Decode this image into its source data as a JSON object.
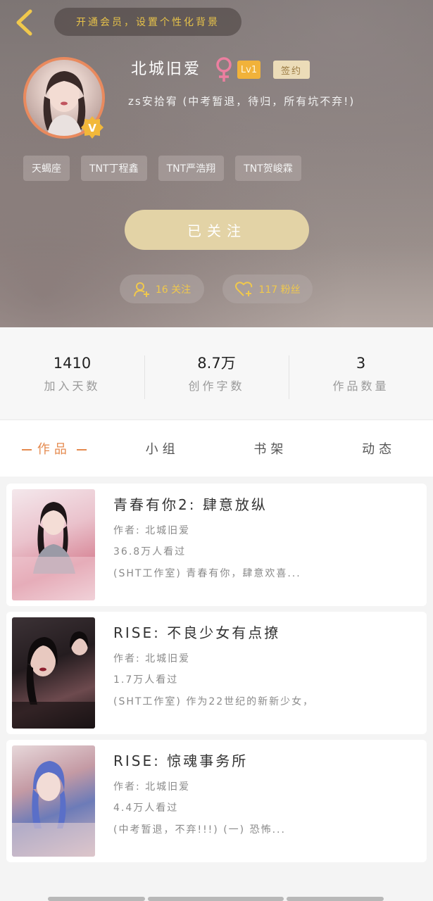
{
  "header": {
    "vip_banner": "开通会员，设置个性化背景",
    "username": "北城旧爱",
    "level_badge": "Lv1",
    "sign_badge": "签约",
    "bio": "zs安拾宥 (中考暂退，待归，所有坑不弃!)",
    "tags": [
      "天蝎座",
      "TNT丁程鑫",
      "TNT严浩翔",
      "TNT贺峻霖"
    ],
    "follow_button": "已关注",
    "following_pill": "16 关注",
    "fans_pill": "117 粉丝",
    "accent_color": "#f1b23a"
  },
  "stats": [
    {
      "value": "1410",
      "label": "加入天数"
    },
    {
      "value": "8.7万",
      "label": "创作字数"
    },
    {
      "value": "3",
      "label": "作品数量"
    }
  ],
  "tabs": [
    "作品",
    "小组",
    "书架",
    "动态"
  ],
  "books": [
    {
      "title": "青春有你2: 肆意放纵",
      "author": "作者: 北城旧爱",
      "views": "36.8万人看过",
      "desc": "(SHT工作室) 青春有你，肆意欢喜..."
    },
    {
      "title": "RISE: 不良少女有点撩",
      "author": "作者: 北城旧爱",
      "views": "1.7万人看过",
      "desc": "(SHT工作室) 作为22世纪的新新少女，"
    },
    {
      "title": "RISE: 惊魂事务所",
      "author": "作者: 北城旧爱",
      "views": "4.4万人看过",
      "desc": "(中考暂退，不弃!!!) (一) 恐怖..."
    }
  ]
}
